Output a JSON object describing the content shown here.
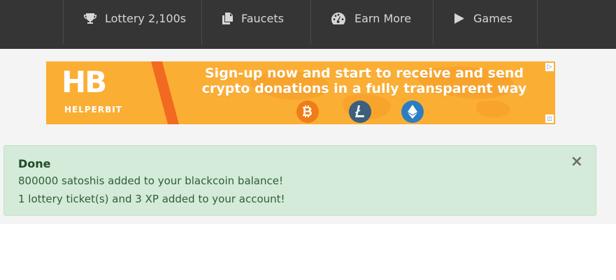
{
  "nav": {
    "items": [
      {
        "label": "Lottery 2,100s",
        "icon": "trophy-icon"
      },
      {
        "label": "Faucets",
        "icon": "copy-icon"
      },
      {
        "label": "Earn More",
        "icon": "speedometer-icon"
      },
      {
        "label": "Games",
        "icon": "play-icon"
      }
    ]
  },
  "ad": {
    "logo_letters": "HB",
    "logo_text": "HELPERBIT",
    "headline_line1": "Sign-up now and start to receive and send",
    "headline_line2": "crypto donations in a fully transparent way",
    "coins": [
      "bitcoin-icon",
      "litecoin-icon",
      "ethereum-icon"
    ],
    "colors": {
      "background": "#fbae34",
      "stripe": "#f26a21"
    }
  },
  "alert": {
    "title": "Done",
    "line1": "800000 satoshis added to your blackcoin balance!",
    "line2": "1 lottery ticket(s) and 3 XP added to your account!",
    "close": "×",
    "colors": {
      "background": "#d4ebd9",
      "text": "#2a5c33"
    }
  }
}
